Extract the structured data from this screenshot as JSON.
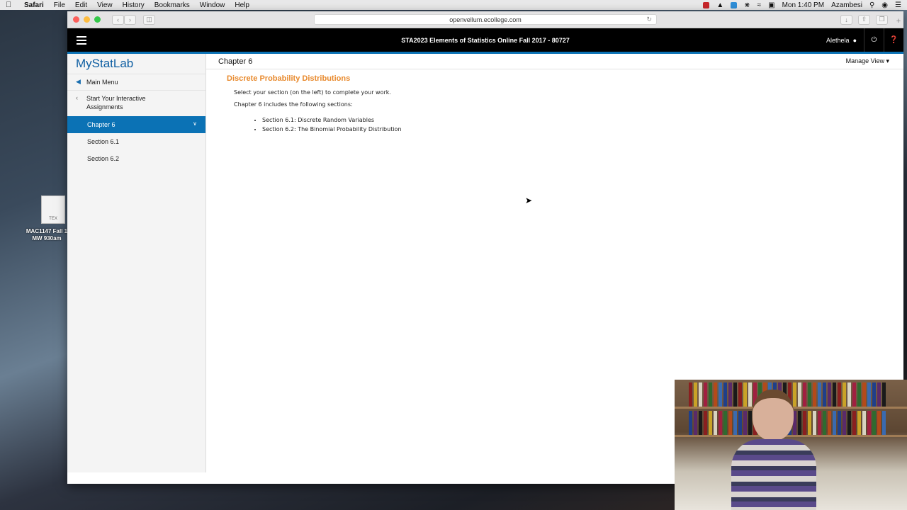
{
  "menubar": {
    "app": "Safari",
    "items": [
      "File",
      "Edit",
      "View",
      "History",
      "Bookmarks",
      "Window",
      "Help"
    ],
    "clock": "Mon 1:40 PM",
    "user": "Azambesi"
  },
  "desktop": {
    "file_label": "MAC1147 Fall 1 MW 930am",
    "file_type": "TEX"
  },
  "browser": {
    "url": "openvellum.ecollege.com"
  },
  "app": {
    "course_title": "STA2023 Elements of Statistics Online Fall 2017 - 80727",
    "user_name": "Alethela"
  },
  "sidebar": {
    "logo": "MyStatLab",
    "main_menu": "Main Menu",
    "back_label": "Start Your Interactive Assignments",
    "active": "Chapter 6",
    "items": [
      "Section 6.1",
      "Section 6.2"
    ]
  },
  "main": {
    "title": "Chapter 6",
    "manage_view": "Manage View",
    "section_title": "Discrete Probability Distributions",
    "instructions": "Select your section (on the left) to complete your work.",
    "includes": "Chapter 6 includes the following sections:",
    "sections": [
      "Section 6.1: Discrete Random Variables",
      "Section 6.2: The Binomial Probability Distribution"
    ]
  },
  "colors": {
    "accent": "#0b72b5",
    "section_title": "#e8892c"
  }
}
